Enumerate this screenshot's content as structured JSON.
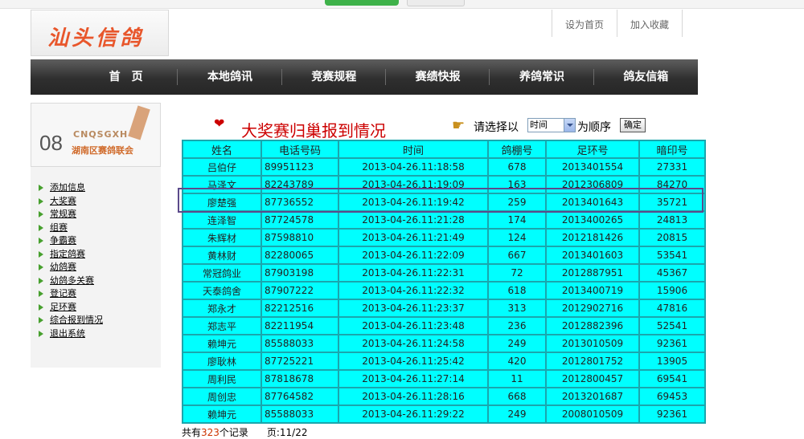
{
  "logo": {
    "text": "汕头信鸽"
  },
  "top_links": [
    "设为首页",
    "加入收藏"
  ],
  "nav": [
    "首　页",
    "本地鸽讯",
    "竞赛规程",
    "赛绩快报",
    "养鸽常识",
    "鸽友信箱"
  ],
  "sidebar": {
    "banner": {
      "number": "08",
      "code": "CNQSGXH",
      "subtitle": "湖南区赛鸽联会"
    },
    "menu": [
      "添加信息",
      "大奖赛",
      "常规赛",
      "组赛",
      "争霸赛",
      "指定鸽赛",
      "幼鸽赛",
      "幼鸽多关赛",
      "登记赛",
      "足环赛",
      "综合报到情况",
      "退出系统"
    ]
  },
  "page": {
    "title": "大奖赛归巢报到情况",
    "sort_label": "请选择以",
    "sort_value": "时间",
    "sort_suffix": "为顺序",
    "ok_label": "确定"
  },
  "table": {
    "headers": [
      "姓名",
      "电话号码",
      "时间",
      "鸽棚号",
      "足环号",
      "暗印号"
    ],
    "rows": [
      [
        "吕伯仔",
        "89951123",
        "2013-04-26.11:18:58",
        "678",
        "2013401554",
        "27331"
      ],
      [
        "马泽文",
        "82243789",
        "2013-04-26.11:19:09",
        "163",
        "2012306809",
        "84270"
      ],
      [
        "廖楚强",
        "87736552",
        "2013-04-26.11:19:42",
        "259",
        "2013401643",
        "35721"
      ],
      [
        "连泽智",
        "87724578",
        "2013-04-26.11:21:28",
        "174",
        "2013400265",
        "24813"
      ],
      [
        "朱辉材",
        "87598810",
        "2013-04-26.11:21:49",
        "124",
        "2012181426",
        "20815"
      ],
      [
        "黄林财",
        "82280065",
        "2013-04-26.11:22:09",
        "667",
        "2013401603",
        "53541"
      ],
      [
        "常冠鸽业",
        "87903198",
        "2013-04-26.11:22:31",
        "72",
        "2012887951",
        "45367"
      ],
      [
        "天泰鸽舍",
        "87907222",
        "2013-04-26.11:22:32",
        "618",
        "2013400719",
        "15906"
      ],
      [
        "郑永才",
        "82212516",
        "2013-04-26.11:23:37",
        "313",
        "2012902716",
        "47816"
      ],
      [
        "郑志平",
        "82211954",
        "2013-04-26.11:23:48",
        "236",
        "2012882396",
        "52541"
      ],
      [
        "赖坤元",
        "85588033",
        "2013-04-26.11:24:58",
        "249",
        "2013010509",
        "92361"
      ],
      [
        "廖耿林",
        "87725221",
        "2013-04-26.11:25:42",
        "420",
        "2012801752",
        "13905"
      ],
      [
        "周利民",
        "87818678",
        "2013-04-26.11:27:14",
        "11",
        "2012800457",
        "69541"
      ],
      [
        "周创忠",
        "87764582",
        "2013-04-26.11:28:16",
        "668",
        "2013201687",
        "69453"
      ],
      [
        "赖坤元",
        "85588033",
        "2013-04-26.11:29:22",
        "249",
        "2008010509",
        "92361"
      ]
    ]
  },
  "footer": {
    "prefix": "共有",
    "count": "323",
    "suffix": "个记录",
    "page_label": "页:",
    "page_value": "11/22"
  },
  "colors": {
    "table_cell": "#00ffff",
    "title_red": "#cc0000",
    "nav_bg": "#2f2f2f"
  }
}
